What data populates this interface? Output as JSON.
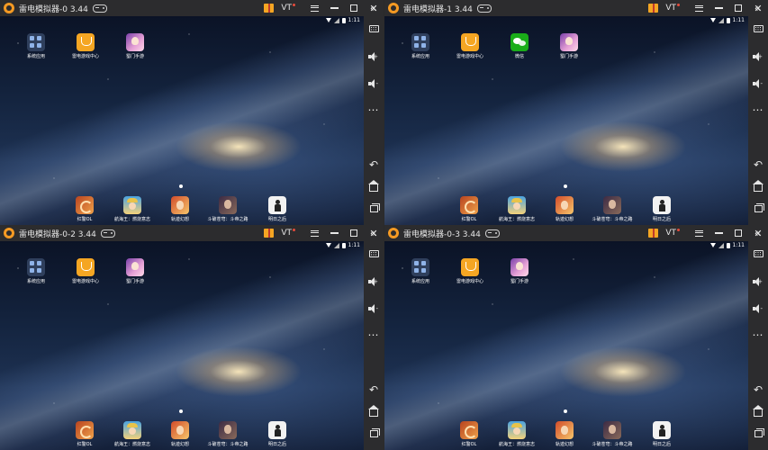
{
  "windows": [
    {
      "title": "雷电模拟器-0 3.44",
      "status_time": "1:11",
      "vt_label": "VT",
      "apps": [
        {
          "label": "系统应用",
          "icon": "system-apps-icon"
        },
        {
          "label": "雷电游戏中心",
          "icon": "game-center-icon"
        },
        {
          "label": "蜀门手游",
          "icon": "shumen-game-icon"
        }
      ],
      "dock": [
        {
          "label": "红警OL",
          "icon": "red-alert-game-icon"
        },
        {
          "label": "航海王：燃烧意志",
          "icon": "one-piece-game-icon"
        },
        {
          "label": "轨迹幻想",
          "icon": "trail-fantasy-game-icon"
        },
        {
          "label": "斗破苍穹：斗帝之路",
          "icon": "battle-through-heavens-game-icon"
        },
        {
          "label": "明日之后",
          "icon": "life-after-game-icon"
        }
      ]
    },
    {
      "title": "雷电模拟器-1 3.44",
      "status_time": "1:11",
      "vt_label": "VT",
      "apps": [
        {
          "label": "系统应用",
          "icon": "system-apps-icon"
        },
        {
          "label": "雷电游戏中心",
          "icon": "game-center-icon"
        },
        {
          "label": "微信",
          "icon": "wechat-icon"
        },
        {
          "label": "蜀门手游",
          "icon": "shumen-game-icon"
        }
      ],
      "dock": [
        {
          "label": "红警OL",
          "icon": "red-alert-game-icon"
        },
        {
          "label": "航海王：燃烧意志",
          "icon": "one-piece-game-icon"
        },
        {
          "label": "轨迹幻想",
          "icon": "trail-fantasy-game-icon"
        },
        {
          "label": "斗破苍穹：斗帝之路",
          "icon": "battle-through-heavens-game-icon"
        },
        {
          "label": "明日之后",
          "icon": "life-after-game-icon"
        }
      ]
    },
    {
      "title": "雷电模拟器-0-2 3.44",
      "status_time": "1:11",
      "vt_label": "VT",
      "apps": [
        {
          "label": "系统应用",
          "icon": "system-apps-icon"
        },
        {
          "label": "雷电游戏中心",
          "icon": "game-center-icon"
        },
        {
          "label": "蜀门手游",
          "icon": "shumen-game-icon"
        }
      ],
      "dock": [
        {
          "label": "红警OL",
          "icon": "red-alert-game-icon"
        },
        {
          "label": "航海王：燃烧意志",
          "icon": "one-piece-game-icon"
        },
        {
          "label": "轨迹幻想",
          "icon": "trail-fantasy-game-icon"
        },
        {
          "label": "斗破苍穹：斗帝之路",
          "icon": "battle-through-heavens-game-icon"
        },
        {
          "label": "明日之后",
          "icon": "life-after-game-icon"
        }
      ]
    },
    {
      "title": "雷电模拟器-0-3 3.44",
      "status_time": "1:11",
      "vt_label": "VT",
      "apps": [
        {
          "label": "系统应用",
          "icon": "system-apps-icon"
        },
        {
          "label": "雷电游戏中心",
          "icon": "game-center-icon"
        },
        {
          "label": "蜀门手游",
          "icon": "shumen-game-icon"
        }
      ],
      "dock": [
        {
          "label": "红警OL",
          "icon": "red-alert-game-icon"
        },
        {
          "label": "航海王：燃烧意志",
          "icon": "one-piece-game-icon"
        },
        {
          "label": "轨迹幻想",
          "icon": "trail-fantasy-game-icon"
        },
        {
          "label": "斗破苍穹：斗帝之路",
          "icon": "battle-through-heavens-game-icon"
        },
        {
          "label": "明日之后",
          "icon": "life-after-game-icon"
        }
      ]
    }
  ],
  "sidebar_icons": [
    "collapse-icon",
    "keyboard-icon",
    "volume-up-icon",
    "volume-down-icon",
    "more-icon",
    "back-icon",
    "home-icon",
    "recent-apps-icon"
  ],
  "colors": {
    "titlebar": "#2c2c2e",
    "logo_orange": "#f59a23",
    "wallpaper_dark": "#0b1326"
  }
}
